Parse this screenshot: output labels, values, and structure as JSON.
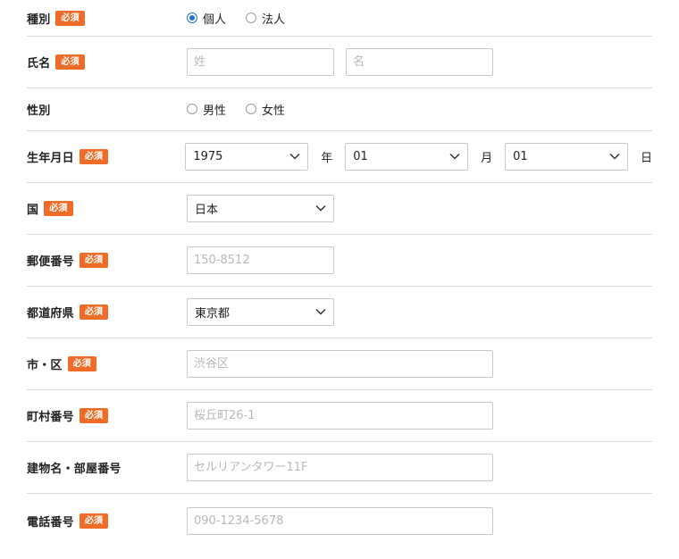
{
  "required_badge": "必須",
  "type": {
    "label": "種別",
    "options": [
      "個人",
      "法人"
    ],
    "selected": 0
  },
  "name": {
    "label": "氏名",
    "last_placeholder": "姓",
    "first_placeholder": "名"
  },
  "gender": {
    "label": "性別",
    "options": [
      "男性",
      "女性"
    ]
  },
  "birthdate": {
    "label": "生年月日",
    "year": "1975",
    "year_unit": "年",
    "month": "01",
    "month_unit": "月",
    "day": "01",
    "day_unit": "日"
  },
  "country": {
    "label": "国",
    "value": "日本"
  },
  "postal": {
    "label": "郵便番号",
    "placeholder": "150-8512"
  },
  "prefecture": {
    "label": "都道府県",
    "value": "東京都"
  },
  "city": {
    "label": "市・区",
    "placeholder": "渋谷区"
  },
  "street": {
    "label": "町村番号",
    "placeholder": "桜丘町26-1"
  },
  "building": {
    "label": "建物名・部屋番号",
    "placeholder": "セルリアンタワー11F"
  },
  "phone": {
    "label": "電話番号",
    "placeholder": "090-1234-5678"
  },
  "colors": {
    "badge": "#ef6c28",
    "radio_selected": "#1a73c8"
  },
  "icons": {
    "select_arrow": "chevron-down-icon"
  }
}
